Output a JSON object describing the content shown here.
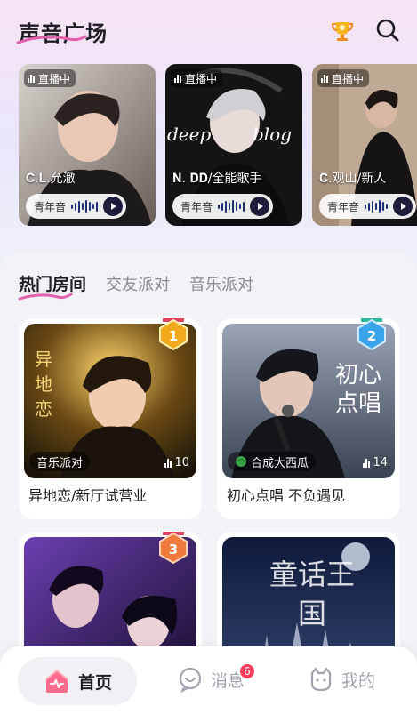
{
  "header": {
    "title": "声音广场",
    "trophy_icon": "trophy-icon",
    "search_icon": "search-icon"
  },
  "live_rooms": [
    {
      "status": "直播中",
      "name": "𝐂.𝐋.允澈",
      "voice_tag": "青年音"
    },
    {
      "status": "直播中",
      "name": "𝐍. 𝐃𝐃/全能歌手",
      "voice_tag": "青年音"
    },
    {
      "status": "直播中",
      "name": "𝐂.观山/新人",
      "voice_tag": "青年音"
    }
  ],
  "tabs": [
    {
      "label": "热门房间",
      "active": true
    },
    {
      "label": "交友派对",
      "active": false
    },
    {
      "label": "音乐派对",
      "active": false
    }
  ],
  "rooms": [
    {
      "title": "异地恋/新厅试营业",
      "rank": "1",
      "tag": "音乐派对",
      "listeners": "10",
      "cover_text": "异地恋"
    },
    {
      "title": "初心点唱 不负遇见",
      "rank": "2",
      "tag": "合成大西瓜",
      "listeners": "14",
      "cover_text": "初心点唱"
    },
    {
      "title": "",
      "rank": "3",
      "tag": "",
      "listeners": ""
    },
    {
      "title": "",
      "rank": "",
      "tag": "",
      "listeners": "",
      "cover_text": "童话王国"
    }
  ],
  "bottom_nav": {
    "home": "首页",
    "messages": "消息",
    "messages_badge": "6",
    "me": "我的"
  },
  "colors": {
    "accent_pink": "#ff3b5c",
    "gold_badge": "#f3a91c",
    "blue_badge": "#3aa4ea",
    "orange_badge": "#f07a3c"
  }
}
